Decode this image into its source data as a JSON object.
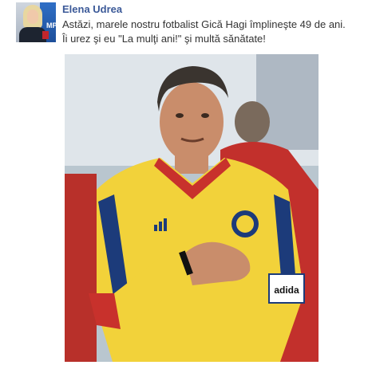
{
  "post": {
    "author": "Elena Udrea",
    "avatar_badge": "MP",
    "message_lines": [
      "Astăzi, marele nostru fotbalist Gică Hagi împlineşte 49 de ani.",
      "Îi urez şi eu \"La mulţi ani!\" şi multă sănătate!"
    ],
    "photo": {
      "armband_text": "adida",
      "shirt_brand_text": "adidas",
      "colors": {
        "shirt": "#f2d23a",
        "collar": "#c8312c",
        "stripes": "#1c3b7a"
      }
    }
  },
  "colors": {
    "author_link": "#3b5998",
    "text": "#333333"
  }
}
